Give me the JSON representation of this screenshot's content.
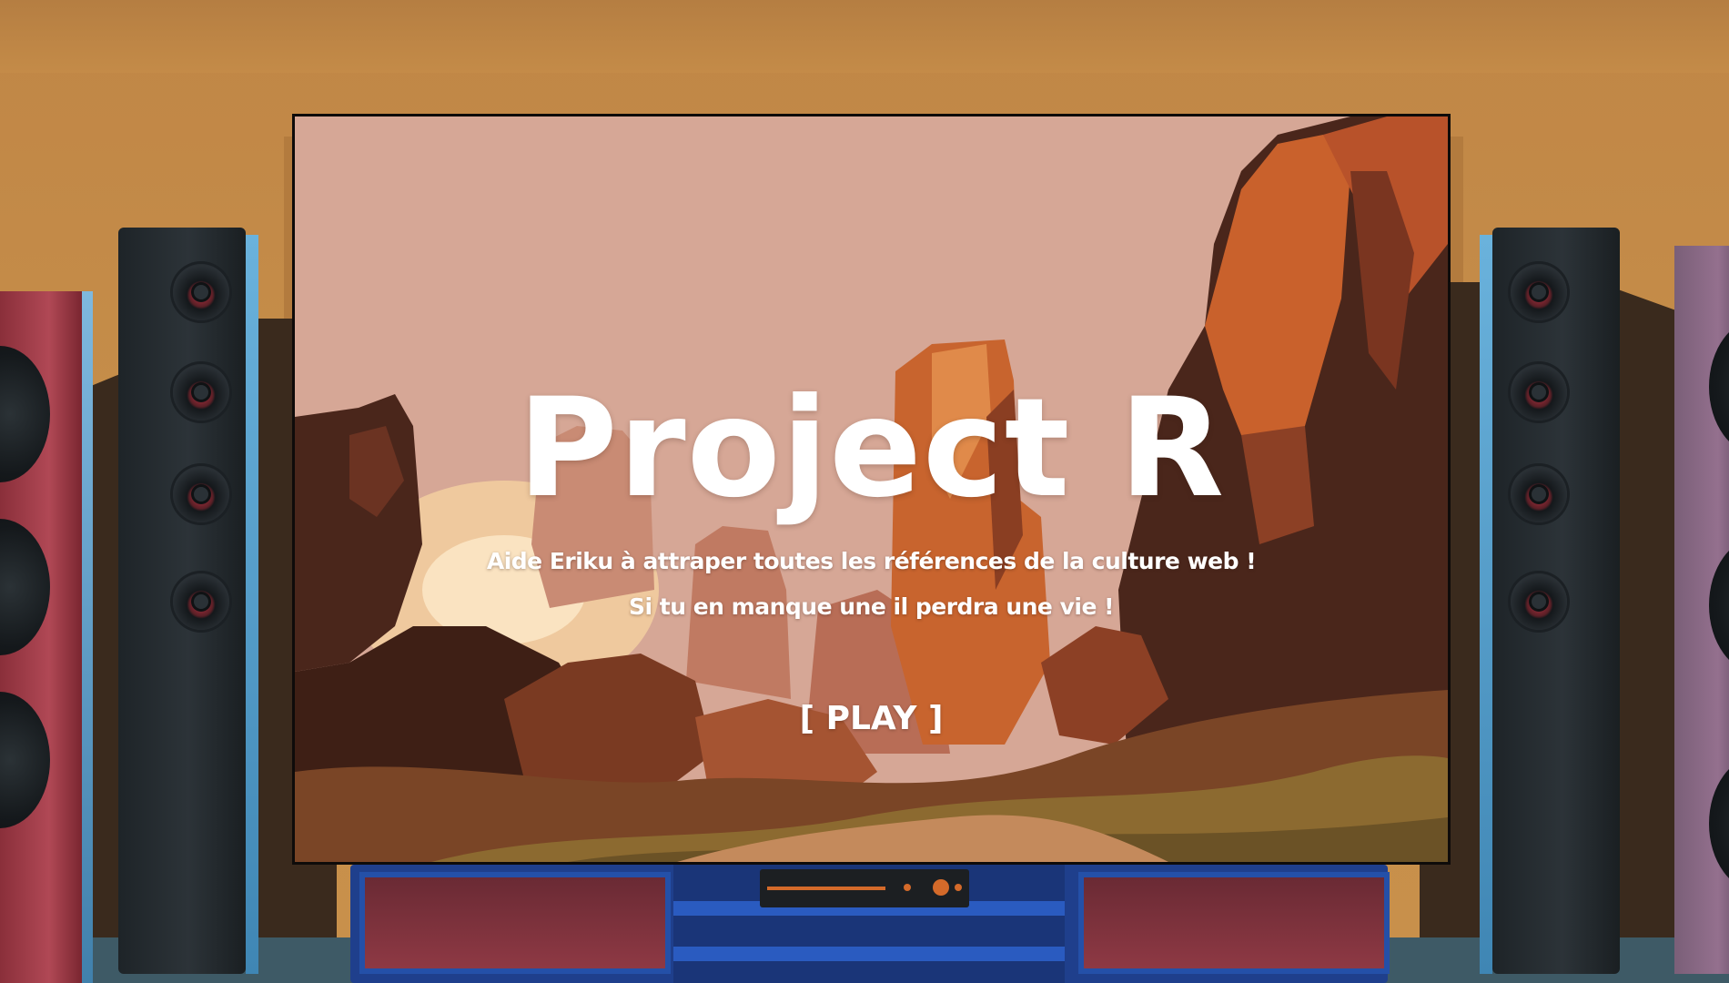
{
  "game": {
    "title": "Project R",
    "subtitle_line1": "Aide Eriku à attraper toutes les références de la culture web !",
    "subtitle_line2": "Si tu en manque une il perdra une vie !",
    "play_label": "[ PLAY ]"
  },
  "colors": {
    "wall": "#c48c48",
    "text": "#ffffff",
    "sky": "#d6a796",
    "speaker_accent": "#6ab2dc",
    "stand": "#1f3f8c",
    "receiver_light": "#d46a2a"
  },
  "icons": {
    "speakers": "speaker-icon",
    "receiver": "receiver-icon"
  }
}
